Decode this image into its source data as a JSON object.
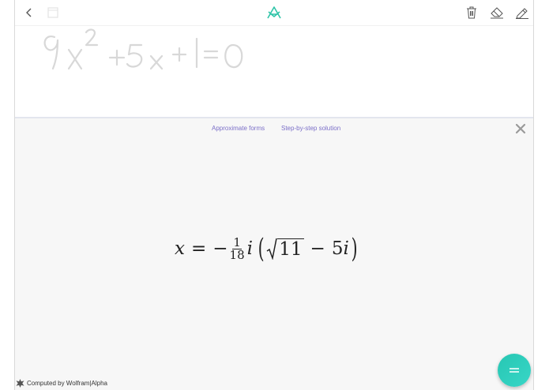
{
  "toolbar": {
    "back_icon": "chevron-left-icon",
    "page_icon": "page-icon",
    "logo_icon": "app-logo-icon",
    "trash_icon": "trash-icon",
    "eraser_icon": "eraser-icon",
    "pencil_icon": "pencil-icon",
    "accent_color": "#2fc4a8"
  },
  "canvas": {
    "handwritten_expression": "9x² + 5x + 1 = 0",
    "ink_color": "#d8d8d8"
  },
  "result_panel": {
    "tabs": [
      {
        "label": "Approximate forms"
      },
      {
        "label": "Step-by-step solution"
      }
    ],
    "close_icon": "close-icon",
    "formula": {
      "var": "x",
      "equals": "=",
      "minus": "−",
      "numerator": "1",
      "denominator": "18",
      "imag": "i",
      "open_paren": "(",
      "sqrt_arg": "11",
      "minus2": "−",
      "coef": "5",
      "imag2": "i",
      "close_paren": ")"
    },
    "footer_text": "Computed by Wolfram|Alpha",
    "fab_icon": "equals-icon"
  }
}
